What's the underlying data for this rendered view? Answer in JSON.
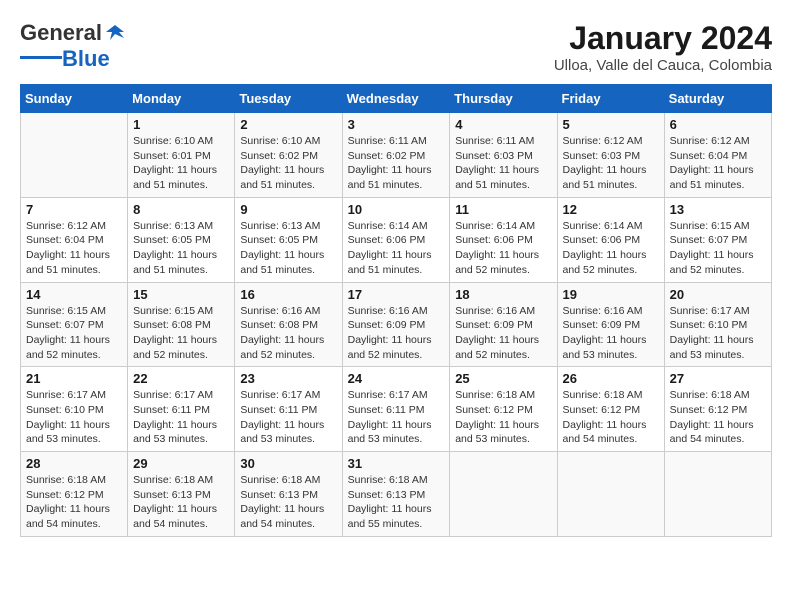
{
  "header": {
    "logo_general": "General",
    "logo_blue": "Blue",
    "title": "January 2024",
    "subtitle": "Ulloa, Valle del Cauca, Colombia"
  },
  "columns": [
    "Sunday",
    "Monday",
    "Tuesday",
    "Wednesday",
    "Thursday",
    "Friday",
    "Saturday"
  ],
  "weeks": [
    [
      {
        "day": "",
        "info": ""
      },
      {
        "day": "1",
        "info": "Sunrise: 6:10 AM\nSunset: 6:01 PM\nDaylight: 11 hours\nand 51 minutes."
      },
      {
        "day": "2",
        "info": "Sunrise: 6:10 AM\nSunset: 6:02 PM\nDaylight: 11 hours\nand 51 minutes."
      },
      {
        "day": "3",
        "info": "Sunrise: 6:11 AM\nSunset: 6:02 PM\nDaylight: 11 hours\nand 51 minutes."
      },
      {
        "day": "4",
        "info": "Sunrise: 6:11 AM\nSunset: 6:03 PM\nDaylight: 11 hours\nand 51 minutes."
      },
      {
        "day": "5",
        "info": "Sunrise: 6:12 AM\nSunset: 6:03 PM\nDaylight: 11 hours\nand 51 minutes."
      },
      {
        "day": "6",
        "info": "Sunrise: 6:12 AM\nSunset: 6:04 PM\nDaylight: 11 hours\nand 51 minutes."
      }
    ],
    [
      {
        "day": "7",
        "info": "Sunrise: 6:12 AM\nSunset: 6:04 PM\nDaylight: 11 hours\nand 51 minutes."
      },
      {
        "day": "8",
        "info": "Sunrise: 6:13 AM\nSunset: 6:05 PM\nDaylight: 11 hours\nand 51 minutes."
      },
      {
        "day": "9",
        "info": "Sunrise: 6:13 AM\nSunset: 6:05 PM\nDaylight: 11 hours\nand 51 minutes."
      },
      {
        "day": "10",
        "info": "Sunrise: 6:14 AM\nSunset: 6:06 PM\nDaylight: 11 hours\nand 51 minutes."
      },
      {
        "day": "11",
        "info": "Sunrise: 6:14 AM\nSunset: 6:06 PM\nDaylight: 11 hours\nand 52 minutes."
      },
      {
        "day": "12",
        "info": "Sunrise: 6:14 AM\nSunset: 6:06 PM\nDaylight: 11 hours\nand 52 minutes."
      },
      {
        "day": "13",
        "info": "Sunrise: 6:15 AM\nSunset: 6:07 PM\nDaylight: 11 hours\nand 52 minutes."
      }
    ],
    [
      {
        "day": "14",
        "info": "Sunrise: 6:15 AM\nSunset: 6:07 PM\nDaylight: 11 hours\nand 52 minutes."
      },
      {
        "day": "15",
        "info": "Sunrise: 6:15 AM\nSunset: 6:08 PM\nDaylight: 11 hours\nand 52 minutes."
      },
      {
        "day": "16",
        "info": "Sunrise: 6:16 AM\nSunset: 6:08 PM\nDaylight: 11 hours\nand 52 minutes."
      },
      {
        "day": "17",
        "info": "Sunrise: 6:16 AM\nSunset: 6:09 PM\nDaylight: 11 hours\nand 52 minutes."
      },
      {
        "day": "18",
        "info": "Sunrise: 6:16 AM\nSunset: 6:09 PM\nDaylight: 11 hours\nand 52 minutes."
      },
      {
        "day": "19",
        "info": "Sunrise: 6:16 AM\nSunset: 6:09 PM\nDaylight: 11 hours\nand 53 minutes."
      },
      {
        "day": "20",
        "info": "Sunrise: 6:17 AM\nSunset: 6:10 PM\nDaylight: 11 hours\nand 53 minutes."
      }
    ],
    [
      {
        "day": "21",
        "info": "Sunrise: 6:17 AM\nSunset: 6:10 PM\nDaylight: 11 hours\nand 53 minutes."
      },
      {
        "day": "22",
        "info": "Sunrise: 6:17 AM\nSunset: 6:11 PM\nDaylight: 11 hours\nand 53 minutes."
      },
      {
        "day": "23",
        "info": "Sunrise: 6:17 AM\nSunset: 6:11 PM\nDaylight: 11 hours\nand 53 minutes."
      },
      {
        "day": "24",
        "info": "Sunrise: 6:17 AM\nSunset: 6:11 PM\nDaylight: 11 hours\nand 53 minutes."
      },
      {
        "day": "25",
        "info": "Sunrise: 6:18 AM\nSunset: 6:12 PM\nDaylight: 11 hours\nand 53 minutes."
      },
      {
        "day": "26",
        "info": "Sunrise: 6:18 AM\nSunset: 6:12 PM\nDaylight: 11 hours\nand 54 minutes."
      },
      {
        "day": "27",
        "info": "Sunrise: 6:18 AM\nSunset: 6:12 PM\nDaylight: 11 hours\nand 54 minutes."
      }
    ],
    [
      {
        "day": "28",
        "info": "Sunrise: 6:18 AM\nSunset: 6:12 PM\nDaylight: 11 hours\nand 54 minutes."
      },
      {
        "day": "29",
        "info": "Sunrise: 6:18 AM\nSunset: 6:13 PM\nDaylight: 11 hours\nand 54 minutes."
      },
      {
        "day": "30",
        "info": "Sunrise: 6:18 AM\nSunset: 6:13 PM\nDaylight: 11 hours\nand 54 minutes."
      },
      {
        "day": "31",
        "info": "Sunrise: 6:18 AM\nSunset: 6:13 PM\nDaylight: 11 hours\nand 55 minutes."
      },
      {
        "day": "",
        "info": ""
      },
      {
        "day": "",
        "info": ""
      },
      {
        "day": "",
        "info": ""
      }
    ]
  ]
}
